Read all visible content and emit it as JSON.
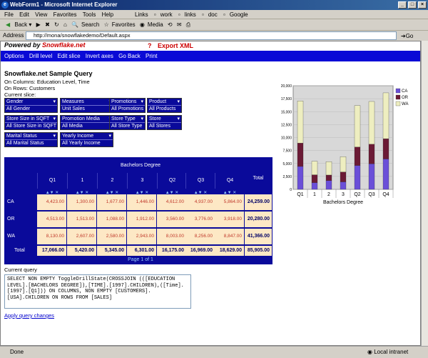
{
  "window": {
    "title": "WebForm1 - Microsoft Internet Explorer"
  },
  "menu": [
    "File",
    "Edit",
    "View",
    "Favorites",
    "Tools",
    "Help"
  ],
  "links_bar": {
    "label": "Links",
    "items": [
      "work",
      "links",
      "doc",
      "Google"
    ]
  },
  "toolbar": {
    "back": "Back",
    "search": "Search",
    "favorites": "Favorites",
    "media": "Media"
  },
  "address": {
    "label": "Address",
    "url": "http://mona/snowflakedemo/Default.aspx",
    "go": "Go"
  },
  "powered": {
    "prefix": "Powered by ",
    "brand": "Snowflake.net",
    "help": "?",
    "export": "Export XML"
  },
  "nav": [
    "Options",
    "Drill level",
    "Edit slice",
    "Invert axes",
    "Go Back",
    "Print"
  ],
  "heading": "Snowflake.net Sample Query",
  "on_columns": "On Columns: Education Level, Time",
  "on_rows": "On Rows: Customers",
  "current_slice_label": "Current slice:",
  "slicers": [
    {
      "title": "Gender",
      "value": "All Gender"
    },
    {
      "title": "Measures",
      "value": "Unit Sales"
    },
    {
      "title": "Promotions",
      "value": "All Promotions"
    },
    {
      "title": "Product",
      "value": "All Products"
    },
    {
      "title": "Store Size in SQFT",
      "value": "All Store Size in SQFT"
    },
    {
      "title": "Promotion Media",
      "value": "All Media"
    },
    {
      "title": "Store Type",
      "value": "All Store Type"
    },
    {
      "title": "Store",
      "value": "All Stores"
    },
    {
      "title": "Marital Status",
      "value": "All Marital Status"
    },
    {
      "title": "Yearly Income",
      "value": "All Yearly Income"
    }
  ],
  "pivot": {
    "group_header": "Bachelors Degree",
    "total_label": "Total",
    "col_headers": [
      "Q1",
      "1",
      "2",
      "3",
      "Q2",
      "Q3",
      "Q4"
    ],
    "rows": [
      {
        "label": "CA",
        "values": [
          "4,423.00",
          "1,300.00",
          "1,677.00",
          "1,446.00",
          "4,612.00",
          "4,937.00",
          "5,864.00"
        ],
        "total": "24,259.00"
      },
      {
        "label": "OR",
        "values": [
          "4,513.00",
          "1,513.00",
          "1,088.00",
          "1,912.00",
          "3,560.00",
          "3,776.00",
          "3,918.00"
        ],
        "total": "20,280.00"
      },
      {
        "label": "WA",
        "values": [
          "8,130.00",
          "2,607.00",
          "2,580.00",
          "2,943.00",
          "8,003.00",
          "8,256.00",
          "8,847.00"
        ],
        "total": "41,366.00"
      }
    ],
    "totals": [
      "17,066.00",
      "5,420.00",
      "5,345.00",
      "6,301.00",
      "16,175.00",
      "16,969.00",
      "18,629.00"
    ],
    "grand_total": "85,905.00",
    "row_total_label": "Total",
    "pager": "Page 1 of 1"
  },
  "query": {
    "label": "Current query",
    "text": "SELECT NON EMPTY ToggleDrillState(CROSSJOIN (([EDUCATION LEVEL].[BACHELORS DEGREE]),[TIME].[1997].CHILDREN),([Time].[1997].[Q1])) ON COLUMNS, NON EMPTY [CUSTOMERS].[USA].CHILDREN ON ROWS FROM [SALES]"
  },
  "apply_link": "Apply query changes",
  "status": {
    "left": "Done",
    "zone": "Local intranet"
  },
  "chart_data": {
    "type": "bar",
    "stacked": true,
    "categories": [
      "Q1",
      "1",
      "2",
      "3",
      "Q2",
      "Q3",
      "Q4"
    ],
    "xlabel": "Bachelors Degree",
    "ylim": [
      0,
      20000
    ],
    "yticks": [
      "0",
      "2,500",
      "5,000",
      "7,500",
      "10,000",
      "12,500",
      "15,000",
      "17,500",
      "20,000"
    ],
    "legend_position": "top-right",
    "series": [
      {
        "name": "CA",
        "color": "#6a4fd8",
        "values": [
          4423,
          1300,
          1677,
          1446,
          4612,
          4937,
          5864
        ]
      },
      {
        "name": "OR",
        "color": "#6b1a35",
        "values": [
          4513,
          1513,
          1088,
          1912,
          3560,
          3776,
          3918
        ]
      },
      {
        "name": "WA",
        "color": "#eeeec0",
        "values": [
          8130,
          2607,
          2580,
          2943,
          8003,
          8256,
          8847
        ]
      }
    ]
  }
}
